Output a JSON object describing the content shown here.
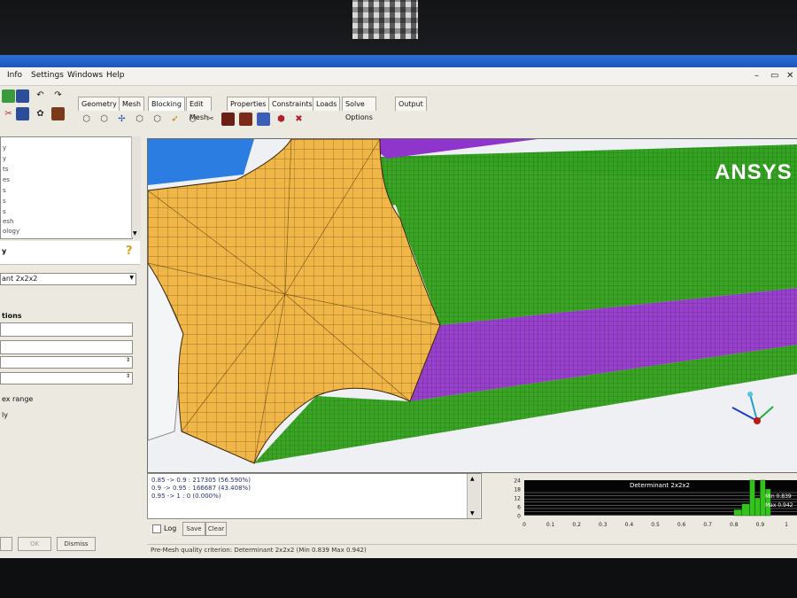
{
  "menu": {
    "items": [
      "Info",
      "Settings",
      "Windows",
      "Help"
    ]
  },
  "tabs": [
    "Geometry",
    "Mesh",
    "Blocking",
    "Edit Mesh",
    "Properties",
    "Constraints",
    "Loads",
    "Solve Options",
    "Output"
  ],
  "active_tab": "Blocking",
  "tree": {
    "items": [
      "y",
      "y",
      "ts",
      "es",
      "s",
      "s",
      "s",
      "esh",
      "ology"
    ]
  },
  "left_panel": {
    "section_title": "y",
    "criterion_select": "ant 2x2x2",
    "options_title": "tions",
    "index_range_label": "ex range",
    "only_label": "ly",
    "ok_button": "OK",
    "dismiss_button": "Dismiss"
  },
  "viewport": {
    "logo": "ANSYS"
  },
  "messages": {
    "lines": [
      "0.85 -> 0.9 : 217305 (56.590%)",
      "0.9 -> 0.95 : 166687 (43.408%)",
      "0.95 -> 1 : 0 (0.000%)"
    ],
    "log_label": "Log",
    "save_label": "Save",
    "clear_label": "Clear"
  },
  "histogram": {
    "title": "Determinant 2x2x2",
    "y_ticks": [
      "24",
      "18",
      "12",
      "6",
      "0"
    ],
    "x_ticks": [
      "0",
      "0.1",
      "0.2",
      "0.3",
      "0.4",
      "0.5",
      "0.6",
      "0.7",
      "0.8",
      "0.9",
      "1"
    ],
    "min_label": "Min 0.839",
    "max_label": "Max 0.942",
    "bins": [
      {
        "from": 0.8,
        "to": 0.83,
        "height": 4
      },
      {
        "from": 0.83,
        "to": 0.86,
        "height": 8
      },
      {
        "from": 0.86,
        "to": 0.88,
        "height": 24
      },
      {
        "from": 0.88,
        "to": 0.9,
        "height": 12
      },
      {
        "from": 0.9,
        "to": 0.92,
        "height": 24
      },
      {
        "from": 0.92,
        "to": 0.94,
        "height": 18
      }
    ],
    "bar_color": "#34c21c"
  },
  "status_text": "Pre-Mesh quality criterion: Determinant 2x2x2 (Min 0.839 Max 0.942)",
  "colors": {
    "interior_face": "#f1b648",
    "mesh_green": "#3aa524",
    "mesh_purple": "#9a3fcf",
    "title_bar": "#1f5bc0"
  }
}
